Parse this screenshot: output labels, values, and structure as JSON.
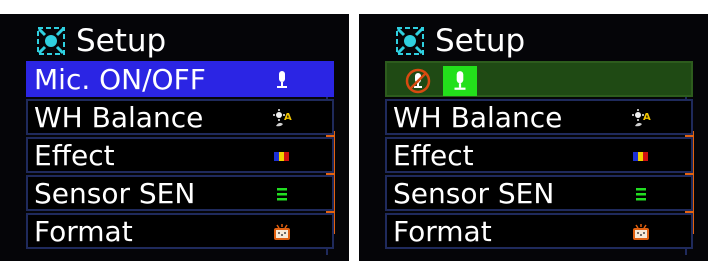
{
  "colors": {
    "screen_bg": "#050508",
    "highlight_blue": "#2b25e4",
    "highlight_green": "#1f4a14",
    "accent_green": "#23e01b",
    "scroll_orange": "#e2620f",
    "row_border": "#1f2a5c"
  },
  "left_panel": {
    "header": {
      "icon": "setup-icon",
      "title": "Setup"
    },
    "items": [
      {
        "label": "Mic. ON/OFF",
        "icon": "microphone-icon",
        "selected": true
      },
      {
        "label": "WH Balance",
        "icon": "white-balance-auto-icon"
      },
      {
        "label": "Effect",
        "icon": "color-effect-icon"
      },
      {
        "label": "Sensor SEN",
        "icon": "sensor-sensitivity-icon"
      },
      {
        "label": "Format",
        "icon": "format-card-icon"
      }
    ]
  },
  "right_panel": {
    "header": {
      "icon": "setup-icon",
      "title": "Setup"
    },
    "mic_options": [
      {
        "icon": "microphone-off-icon",
        "selected": false
      },
      {
        "icon": "microphone-on-icon",
        "selected": true
      }
    ],
    "items": [
      {
        "label": "WH Balance",
        "icon": "white-balance-auto-icon"
      },
      {
        "label": "Effect",
        "icon": "color-effect-icon"
      },
      {
        "label": "Sensor SEN",
        "icon": "sensor-sensitivity-icon"
      },
      {
        "label": "Format",
        "icon": "format-card-icon"
      }
    ]
  }
}
